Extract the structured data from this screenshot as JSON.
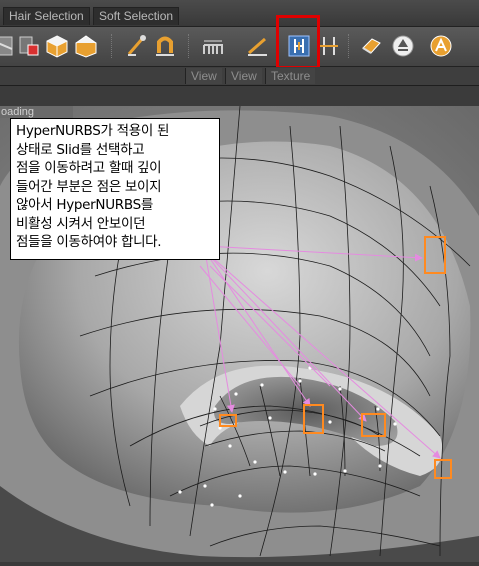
{
  "menubar": {
    "tabs": [
      "Hair Selection",
      "Soft Selection"
    ]
  },
  "toolbar": {
    "tools": [
      {
        "name": "tool-icon-1",
        "label": ""
      },
      {
        "name": "tool-icon-2",
        "label": ""
      },
      {
        "name": "cube-icon",
        "label": ""
      },
      {
        "name": "cube-open-icon",
        "label": ""
      },
      {
        "name": "brush-icon",
        "label": ""
      },
      {
        "name": "magnet-icon",
        "label": ""
      },
      {
        "name": "bridge-icon",
        "label": ""
      },
      {
        "name": "knife-icon",
        "label": ""
      },
      {
        "name": "slide-icon",
        "label": ""
      },
      {
        "name": "slide-alt-icon",
        "label": ""
      },
      {
        "name": "smooth-icon",
        "label": ""
      },
      {
        "name": "recycle-icon",
        "label": ""
      },
      {
        "name": "magic-icon",
        "label": ""
      }
    ],
    "highlight_color": "#e00000"
  },
  "viewbar": {
    "tabs": [
      "View",
      "View",
      "Texture"
    ]
  },
  "viewport": {
    "loading_text": "oading",
    "marker_color": "#ff8a20",
    "arrow_color": "#e58be0"
  },
  "callout": {
    "lines": [
      "HyperNURBS가 적용이 된",
      "상태로 Slid를 선택하고",
      "점을 이동하려고 할때 깊이",
      "들어간 부분은 점은  보이지",
      "않아서 HyperNURBS를",
      "비활성 시켜서 안보이던",
      "점들을 이동하여야 합니다."
    ]
  }
}
